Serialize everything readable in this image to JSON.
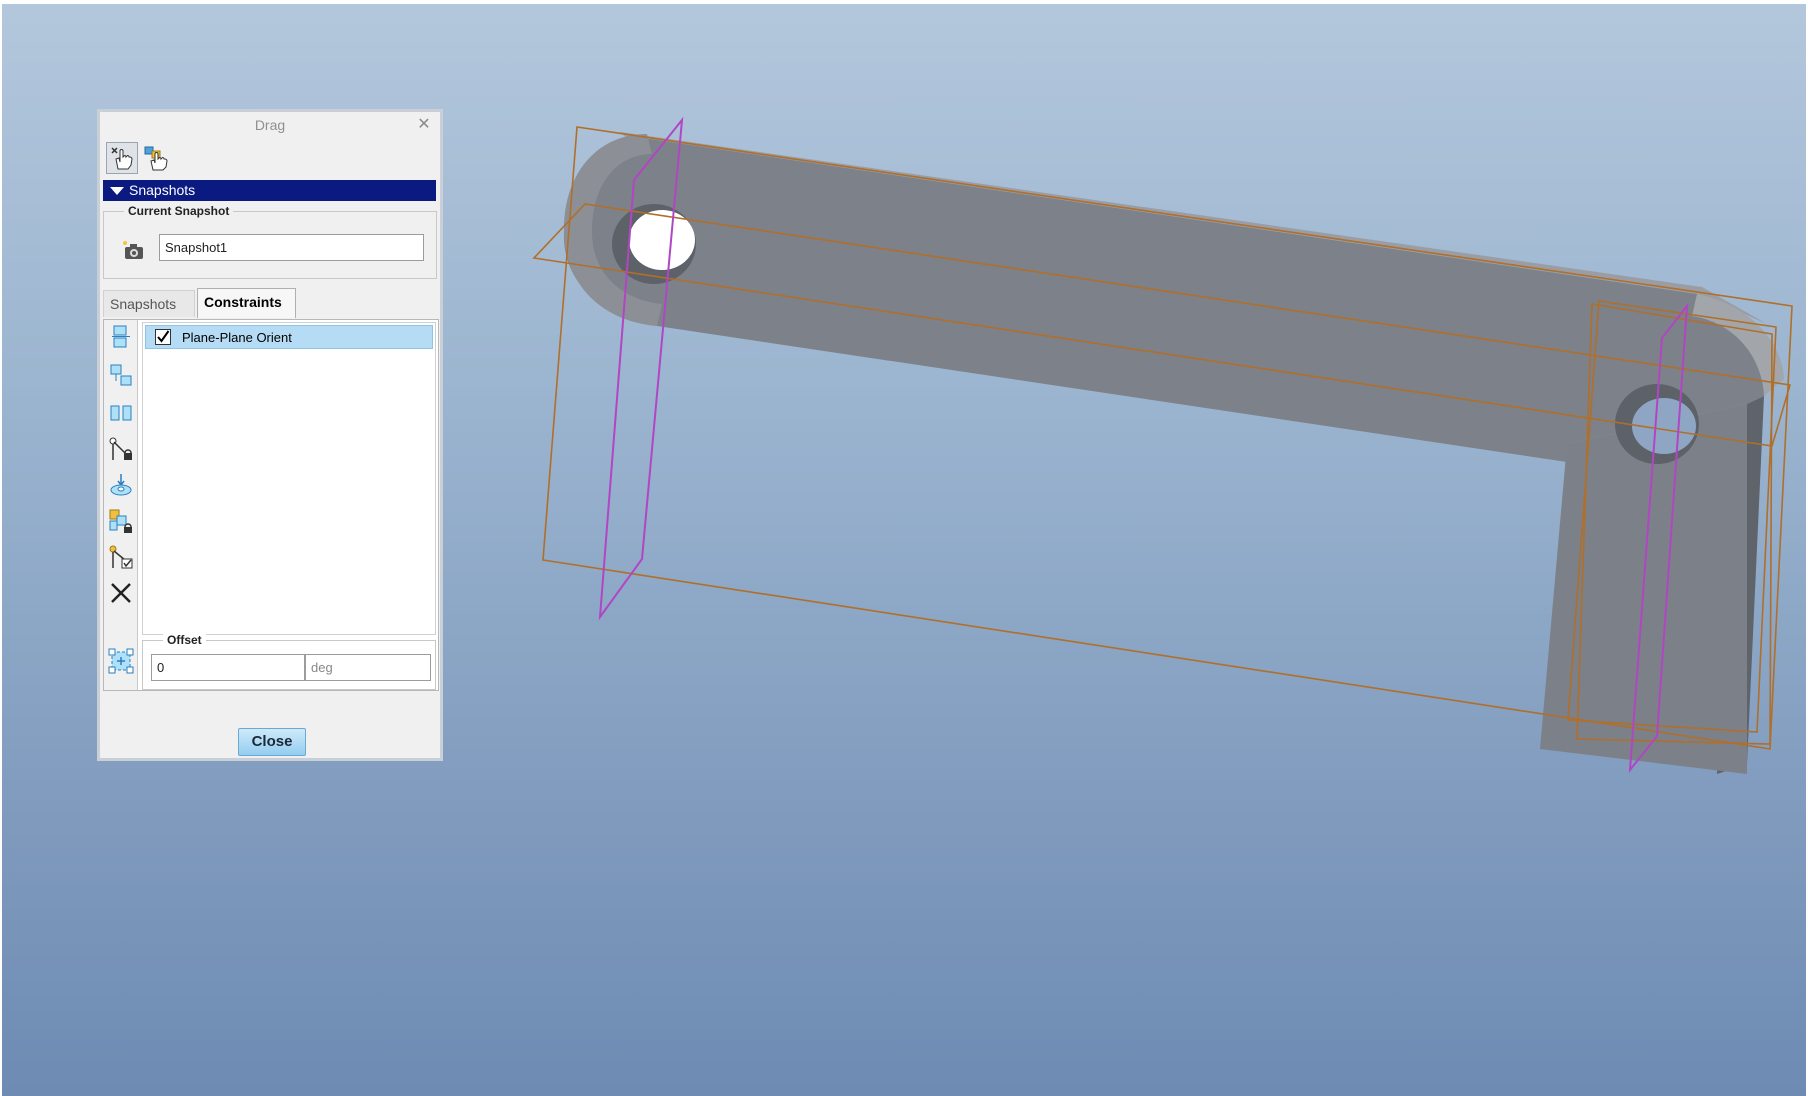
{
  "dialog": {
    "title": "Drag",
    "close_icon": "close-x-icon",
    "modes": [
      {
        "name": "drag-point-mode",
        "icon": "hand-pointer-icon",
        "active": true
      },
      {
        "name": "drag-body-mode",
        "icon": "hand-body-icon",
        "active": false
      }
    ],
    "section_header": "Snapshots",
    "current_snapshot": {
      "group_label": "Current Snapshot",
      "icon": "camera-icon",
      "value": "Snapshot1"
    },
    "tabs": [
      {
        "label": "Snapshots",
        "active": false
      },
      {
        "label": "Constraints",
        "active": true
      }
    ],
    "constraint_tools": [
      "align-two-entities-icon",
      "mate-two-entities-icon",
      "orient-two-planes-icon",
      "motion-axis-constraint-icon",
      "body-body-lock-icon",
      "lock-bodies-icon",
      "enable-disable-connection-icon",
      "delete-constraint-icon"
    ],
    "constraints": [
      {
        "label": "Plane-Plane Orient",
        "checked": true
      }
    ],
    "offset": {
      "group_label": "Offset",
      "value": "0",
      "unit": "deg",
      "icon": "assembly-offset-icon"
    },
    "close_button": "Close"
  },
  "colors": {
    "section_header_bg": "#0b1a80",
    "selected_row_bg": "#b6dcf5",
    "part_color": "#7c8088",
    "datum_plane_color": "#b06f2a",
    "highlight_plane_color": "#b146c4"
  }
}
